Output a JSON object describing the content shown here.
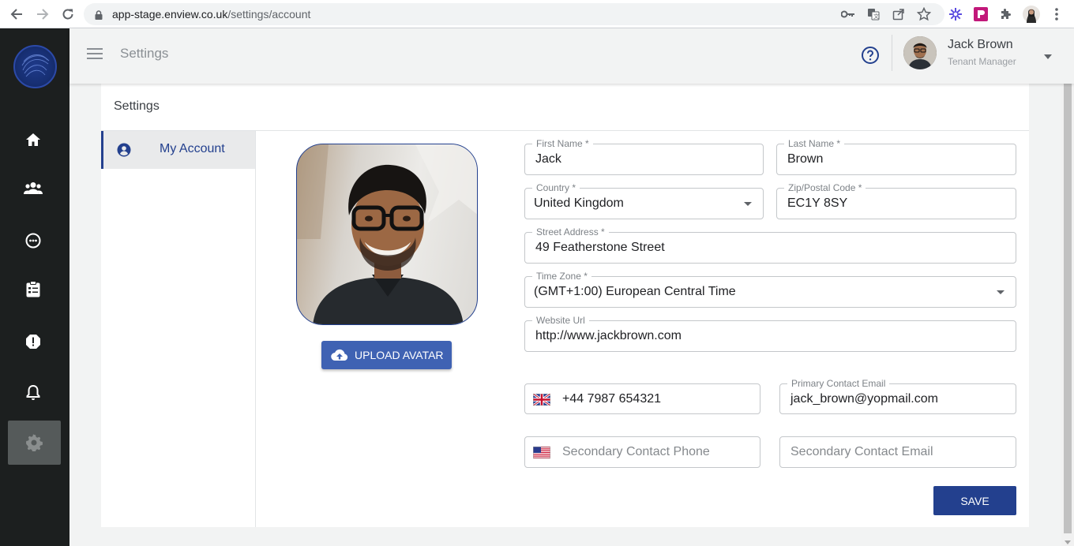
{
  "browser": {
    "url_host": "app-stage.enview.co.uk",
    "url_path": "/settings/account"
  },
  "appbar": {
    "title": "Settings",
    "user_name": "Jack Brown",
    "user_role": "Tenant Manager"
  },
  "card": {
    "title": "Settings",
    "menu": [
      {
        "label": "My Account",
        "icon": "account-circle-icon",
        "active": true
      }
    ]
  },
  "avatar": {
    "upload_label": "UPLOAD AVATAR"
  },
  "form": {
    "first_name": {
      "label": "First Name *",
      "value": "Jack"
    },
    "last_name": {
      "label": "Last Name *",
      "value": "Brown"
    },
    "country": {
      "label": "Country *",
      "value": "United Kingdom"
    },
    "zip": {
      "label": "Zip/Postal Code *",
      "value": "EC1Y 8SY"
    },
    "street": {
      "label": "Street Address *",
      "value": "49 Featherstone Street"
    },
    "timezone": {
      "label": "Time Zone *",
      "value": "(GMT+1:00) European Central Time"
    },
    "website": {
      "label": "Website Url",
      "value": "http://www.jackbrown.com"
    },
    "primary_phone": {
      "value": "+44 7987 654321",
      "flag": "uk-flag-icon"
    },
    "primary_email": {
      "label": "Primary Contact Email",
      "value": "jack_brown@yopmail.com"
    },
    "secondary_phone": {
      "placeholder": "Secondary Contact Phone",
      "flag": "us-flag-icon"
    },
    "secondary_email": {
      "placeholder": "Secondary Contact Email"
    },
    "save_label": "SAVE"
  },
  "colors": {
    "primary": "#23408e",
    "upload_button": "#3f62b3",
    "rail": "#1c1f1f"
  }
}
